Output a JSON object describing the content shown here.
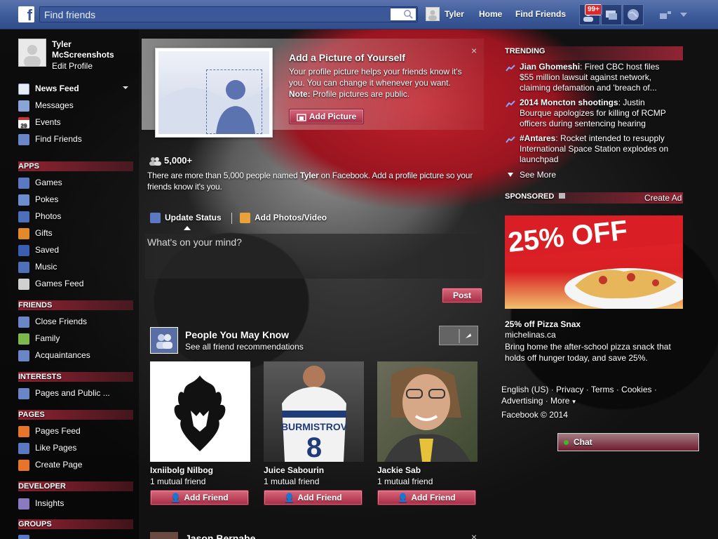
{
  "topbar": {
    "search_placeholder": "Find friends",
    "user_name": "Tyler",
    "home_label": "Home",
    "find_friends_label": "Find Friends",
    "notification_badge": "99+"
  },
  "profile": {
    "name": "Tyler McScreenshots",
    "edit_label": "Edit Profile"
  },
  "nav": {
    "favorites": [
      {
        "label": "News Feed",
        "icon": "news-feed-icon"
      },
      {
        "label": "Messages",
        "icon": "messages-icon"
      },
      {
        "label": "Events",
        "icon": "events-icon",
        "date": "29"
      },
      {
        "label": "Find Friends",
        "icon": "find-friends-icon"
      }
    ],
    "apps_header": "APPS",
    "apps": [
      {
        "label": "Games",
        "icon": "games-icon"
      },
      {
        "label": "Pokes",
        "icon": "pokes-icon"
      },
      {
        "label": "Photos",
        "icon": "photos-icon"
      },
      {
        "label": "Gifts",
        "icon": "gifts-icon"
      },
      {
        "label": "Saved",
        "icon": "saved-icon"
      },
      {
        "label": "Music",
        "icon": "music-icon"
      },
      {
        "label": "Games Feed",
        "icon": "games-feed-icon"
      }
    ],
    "friends_header": "FRIENDS",
    "friends": [
      {
        "label": "Close Friends",
        "icon": "close-friends-icon"
      },
      {
        "label": "Family",
        "icon": "family-icon"
      },
      {
        "label": "Acquaintances",
        "icon": "acquaintances-icon"
      }
    ],
    "interests_header": "INTERESTS",
    "interests": [
      {
        "label": "Pages and Public ...",
        "icon": "pages-public-icon"
      }
    ],
    "pages_header": "PAGES",
    "pages": [
      {
        "label": "Pages Feed",
        "icon": "pages-feed-icon"
      },
      {
        "label": "Like Pages",
        "icon": "like-pages-icon"
      },
      {
        "label": "Create Page",
        "icon": "create-page-icon"
      }
    ],
    "developer_header": "DEVELOPER",
    "developer": [
      {
        "label": "Insights",
        "icon": "insights-icon"
      }
    ],
    "groups_header": "GROUPS"
  },
  "profile_prompt": {
    "title": "Add a Picture of Yourself",
    "desc_1": "Your profile picture helps your friends know it's you. You can change it whenever you want.",
    "note_label": "Note:",
    "note_text": "Profile pictures are public.",
    "button": "Add Picture",
    "close": "×",
    "people_count": "5,000+",
    "people_desc_1": "There are more than 5,000 people named ",
    "people_desc_name": "Tyler",
    "people_desc_2": " on Facebook. Add a profile picture so your friends know it's you."
  },
  "composer": {
    "tab_status": "Update Status",
    "tab_photos": "Add Photos/Video",
    "placeholder": "What's on your mind?",
    "post_button": "Post"
  },
  "pymk": {
    "title": "People You May Know",
    "subtitle": "See all friend recommendations",
    "people": [
      {
        "name": "Ixniibolg Nilbog",
        "mutual": "1 mutual friend",
        "button": "Add Friend"
      },
      {
        "name": "Juice Sabourin",
        "mutual": "1 mutual friend",
        "button": "Add Friend",
        "jersey_name": "BURMISTROV",
        "jersey_number": "8"
      },
      {
        "name": "Jackie Sab",
        "mutual": "1 mutual friend",
        "button": "Add Friend"
      }
    ]
  },
  "next_story": {
    "name": "Jason Bernabe",
    "close": "×"
  },
  "trending": {
    "header": "TRENDING",
    "items": [
      {
        "topic": "Jian Ghomeshi",
        "text": ": Fired CBC host files $55 million lawsuit against network, claiming defamation and 'breach of..."
      },
      {
        "topic": "2014 Moncton shootings",
        "text": ": Justin Bourque apologizes for killing of RCMP officers during sentencing hearing"
      },
      {
        "topic": "#Antares",
        "text": ": Rocket intended to resupply International Space Station explodes on launchpad"
      }
    ],
    "see_more": "See More"
  },
  "sponsored": {
    "header": "SPONSORED",
    "create_ad": "Create Ad",
    "ad_headline": "25% OFF",
    "ad_title": "25% off Pizza Snax",
    "ad_domain": "michelinas.ca",
    "ad_body": "Bring home the after-school pizza snack that holds off hunger today, and save 25%."
  },
  "footer": {
    "links": [
      "English (US)",
      "Privacy",
      "Terms",
      "Cookies",
      "Advertising",
      "More"
    ],
    "copyright": "Facebook © 2014"
  },
  "chat": {
    "label": "Chat"
  },
  "colors": {
    "brand_blue": "#3b5998",
    "accent_red": "#a8283a",
    "badge_red": "#e2262b"
  }
}
